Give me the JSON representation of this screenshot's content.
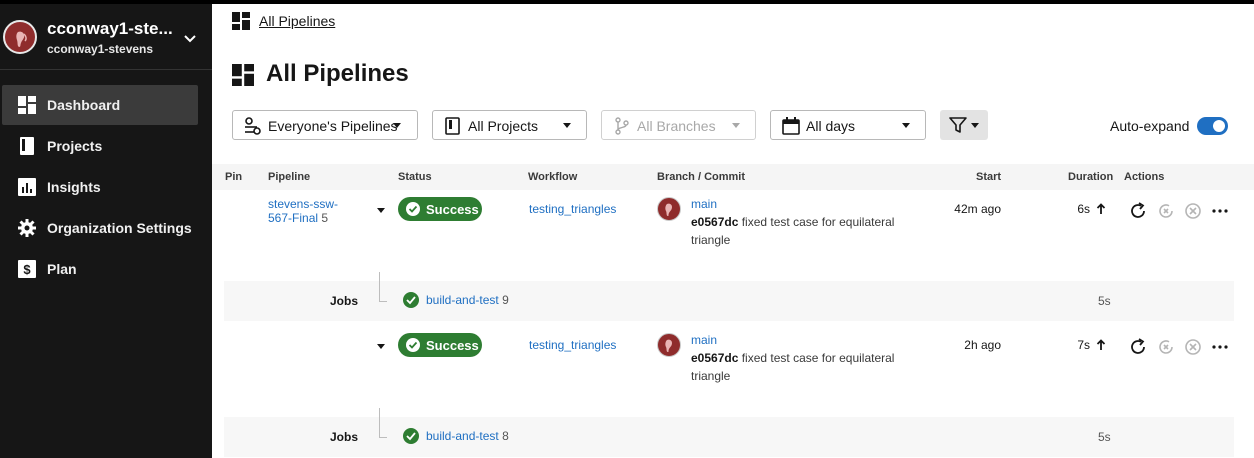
{
  "sidebar": {
    "org_name": "cconway1-ste...",
    "org_user": "cconway1-stevens",
    "items": [
      {
        "label": "Dashboard",
        "icon": "dashboard-icon",
        "active": true
      },
      {
        "label": "Projects",
        "icon": "projects-icon",
        "active": false
      },
      {
        "label": "Insights",
        "icon": "insights-icon",
        "active": false
      },
      {
        "label": "Organization Settings",
        "icon": "gear-icon",
        "active": false
      },
      {
        "label": "Plan",
        "icon": "dollar-icon",
        "active": false
      }
    ]
  },
  "breadcrumb": {
    "label": "All Pipelines"
  },
  "page": {
    "title": "All Pipelines"
  },
  "filters": {
    "pipelines": "Everyone's Pipelines",
    "projects": "All Projects",
    "branches": "All Branches",
    "days": "All days"
  },
  "auto_expand": {
    "label": "Auto-expand",
    "enabled": true
  },
  "table": {
    "headers": [
      "Pin",
      "Pipeline",
      "Status",
      "Workflow",
      "Branch / Commit",
      "Start",
      "Duration",
      "Actions"
    ]
  },
  "rows": [
    {
      "pipeline": "stevens-ssw-567-Final",
      "pipeline_number": "5",
      "status": "Success",
      "workflow": "testing_triangles",
      "branch": "main",
      "commit_hash": "e0567dc",
      "commit_message": "fixed test case for equilateral triangle",
      "start": "42m ago",
      "duration": "6s",
      "jobs_label": "Jobs",
      "job_name": "build-and-test",
      "job_number": "9",
      "job_duration": "5s"
    },
    {
      "pipeline": "",
      "pipeline_number": "",
      "status": "Success",
      "workflow": "testing_triangles",
      "branch": "main",
      "commit_hash": "e0567dc",
      "commit_message": "fixed test case for equilateral triangle",
      "start": "2h ago",
      "duration": "7s",
      "jobs_label": "Jobs",
      "job_name": "build-and-test",
      "job_number": "8",
      "job_duration": "5s"
    }
  ],
  "colors": {
    "sidebar_bg": "#161616",
    "success": "#2e7d32",
    "link": "#1f6fc2",
    "toggle": "#1f6fc2"
  }
}
